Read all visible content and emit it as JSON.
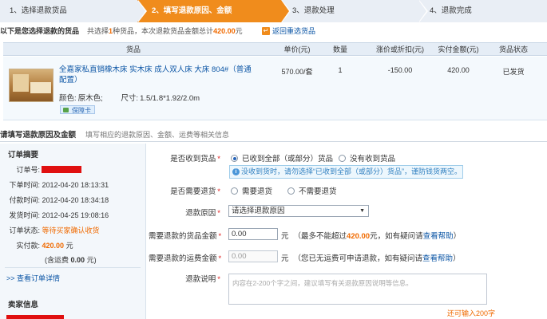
{
  "steps": [
    "1、选择退款货品",
    "2、填写退款原因、金额",
    "3、退款处理",
    "4、退款完成"
  ],
  "summary": {
    "title": "以下是您选择退款的货品",
    "count_prefix": "共选择",
    "count": "1",
    "count_suffix": "种货品，本次退款货品金额总计",
    "amount": "420.00",
    "amount_suffix": "元",
    "back_label": "返回重选货品"
  },
  "table": {
    "headers": [
      "货品",
      "单价(元)",
      "数量",
      "涨价或折扣(元)",
      "实付金额(元)",
      "货品状态"
    ],
    "row": {
      "title": "全嘉家私直销橡木床 实木床 成人双人床 大床 804#（普通配置）",
      "color_label": "颜色:",
      "color_value": "原木色;",
      "size_label": "尺寸:",
      "size_value": "1.5/1.8*1.92/2.0m",
      "guarantee": "保障卡",
      "price": "570.00/套",
      "quantity": "1",
      "discount": "-150.00",
      "paid": "420.00",
      "status": "已发货"
    }
  },
  "section": {
    "title": "请填写退款原因及金额",
    "desc": "填写相应的退款原因、金额、运费等相关信息"
  },
  "order": {
    "title": "订单摘要",
    "order_no_label": "订单号:",
    "created_label": "下单时间:",
    "created": "2012-04-20 18:13:31",
    "paid_label": "付款时间:",
    "paid_time": "2012-04-20 18:34:18",
    "shipped_label": "发货时间:",
    "shipped": "2012-04-25 19:08:16",
    "status_label": "订单状态:",
    "status": "等待买家确认收货",
    "amount_label": "实付款:",
    "amount": "420.00",
    "amount_unit": "元",
    "freight_prefix": "(含运费",
    "freight": "0.00",
    "freight_suffix": "元)",
    "detail_link": ">> 查看订单详情",
    "seller_title": "卖家信息"
  },
  "form": {
    "received_label": "是否收到货品",
    "received_yes": "已收到全部（或部分）货品",
    "received_no": "没有收到货品",
    "tip": "没收到货时，请勿选择“已收到全部（或部分）货品”，谨防钱货两空。",
    "return_label": "是否需要退货",
    "return_yes": "需要退货",
    "return_no": "不需要退货",
    "reason_label": "退款原因",
    "reason_value": "请选择退款原因",
    "amount_label": "需要退款的货品金额",
    "amount_value": "0.00",
    "amount_unit": "元",
    "amount_hint_prefix": "（最多不能超过",
    "amount_max": "420.00",
    "amount_hint_mid": "元，如有疑问请",
    "help": "查看帮助",
    "amount_hint_suffix": "）",
    "freight_label": "需要退款的运费金额",
    "freight_value": "0.00",
    "freight_unit": "元",
    "freight_hint": "（您已无运费可申请退款，如有疑问请",
    "freight_hint_suffix": "）",
    "note_label": "退款说明",
    "note_placeholder": "内容在2-200个字之间，建议填写有关退款原因说明等信息。",
    "counter": "还可输入200字"
  }
}
